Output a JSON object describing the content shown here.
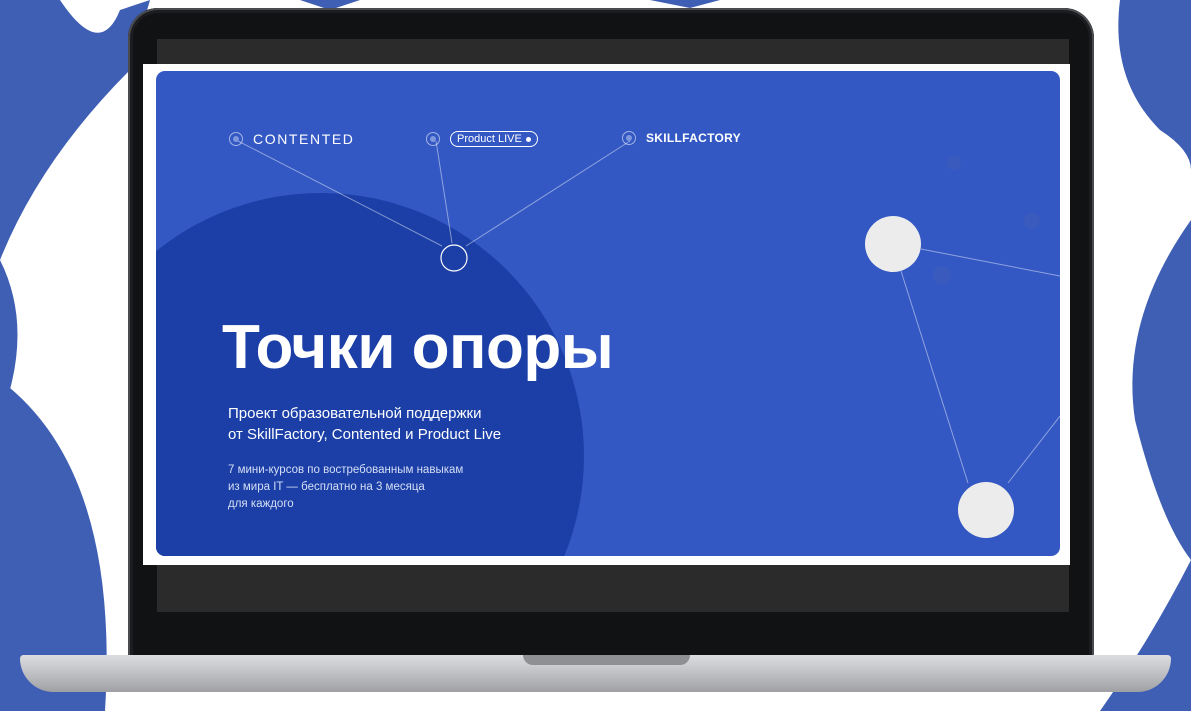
{
  "colors": {
    "accent_blue": "#3358c4",
    "dark_blue_circle": "#1b3fa6",
    "decor_blue": "#3f5fb4"
  },
  "partners": [
    {
      "label": "CONTENTED",
      "icon": "circle-dot-icon"
    },
    {
      "label": "Product LIVE",
      "icon": "circle-dot-icon"
    },
    {
      "label": "SKILLFACTORY",
      "icon": "circle-dot-icon"
    }
  ],
  "hero": {
    "title": "Точки опоры",
    "subtitle_lines": [
      "Проект образовательной поддержки",
      "от SkillFactory, Contented и Product Live"
    ],
    "description_lines": [
      "7 мини-курсов по востребованным навыкам",
      "из мира IT — бесплатно на 3 месяца",
      "для каждого"
    ]
  }
}
